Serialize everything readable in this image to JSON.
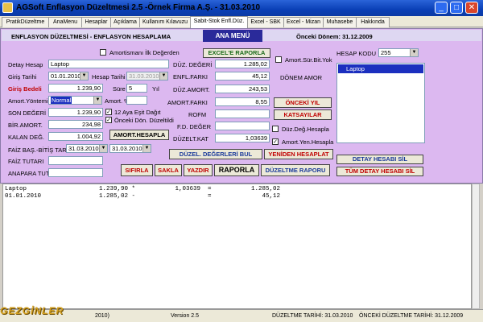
{
  "window": {
    "title": "AGSoft Enflasyon Düzeltmesi 2.5 -Örnek Firma A.Ş. - 31.03.2010"
  },
  "tabs": [
    {
      "label": "PratikDüzeltme"
    },
    {
      "label": "AnaMenu"
    },
    {
      "label": "Hesaplar"
    },
    {
      "label": "Açıklama"
    },
    {
      "label": "Kullanım Kılavuzu"
    },
    {
      "label": "Sabit-Stok Enfl.Düz."
    },
    {
      "label": "Excel - SBK"
    },
    {
      "label": "Excel - Mizan"
    },
    {
      "label": "Muhasebe"
    },
    {
      "label": "Hakkında"
    }
  ],
  "header": {
    "section_title": "ENFLASYON DÜZELTMESİ - ENFLASYON HESAPLAMA",
    "ana_menu": "ANA MENÜ",
    "onceki_donem": "Önceki Dönem: 31.12.2009"
  },
  "form": {
    "amortismani_ilk_degerden": "Amortismanı İlk Değerden",
    "detay_hesap_label": "Detay Hesap",
    "detay_hesap_value": "Laptop",
    "giris_tarihi_label": "Giriş Tarihi",
    "giris_tarihi_value": "01.01.2010",
    "hesap_tarihi_label": "Hesap Tarihi",
    "hesap_tarihi_value": "31.03.2010",
    "giris_bedeli_label": "Giriş Bedeli",
    "giris_bedeli_value": "1.239,90",
    "sure_label": "Süre",
    "sure_value": "5",
    "yil_label": "Yıl",
    "amort_yontemi_label": "Amort.Yöntemi",
    "amort_yontemi_value": "Normal",
    "amort_pct_label": "Amort. %",
    "amort_pct_value": "",
    "son_degeri_label": "SON DEĞERİ",
    "son_degeri_value": "1.239,90",
    "ay_esit_dagit": "12 Aya Eşit Dağıt",
    "onceki_don_duzeltildi": "Önceki Dön. Düzeltildi",
    "bir_amort_label": "BİR.AMORT.",
    "bir_amort_value": "234,98",
    "kalan_deg_label": "KALAN DEĞ.",
    "kalan_deg_value": "1.004,92",
    "amort_hesapla": "AMORT.HESAPLA",
    "faiz_bas_bitis_label": "FAİZ BAŞ.-BİTİŞ TAR.",
    "faiz_bas_value": "31.03.2010",
    "faiz_bitis_value": "31.03.2010",
    "faiz_tutari_label": "FAİZ TUTARI",
    "faiz_tutari_value": "",
    "anapara_tut_label": "ANAPARA TUT.",
    "anapara_tut_value": ""
  },
  "mid": {
    "duz_degeri_label": "DÜZ. DEĞERİ",
    "duz_degeri_value": "1.285,02",
    "enfl_farki_label": "ENFL.FARKI",
    "enfl_farki_value": "45,12",
    "duz_amort_label": "DÜZ.AMORT.",
    "duz_amort_value": "243,53",
    "amort_farki_label": "AMORT.FARKI",
    "amort_farki_value": "8,55",
    "rofm_label": "ROFM",
    "rofm_value": "",
    "fd_degeri_label": "F.D. DEĞER",
    "fd_degeri_value": "",
    "duzelt_kat_label": "DÜZELT.KAT",
    "duzelt_kat_value": "1,03639",
    "excel_raporla": "EXCEL'E RAPORLA"
  },
  "right": {
    "amort_sur_bit_yok": "Amort.Sür.Bit.Yok",
    "donem_amor": "DÖNEM AMOR",
    "onceki_yil": "ÖNCEKİ YIL",
    "katsayilar": "KATSAYILAR",
    "duz_deg_hesapla": "Düz.Değ.Hesapla",
    "amort_yen_hesapla": "Amort.Yen.Hesapla",
    "hesap_kodu_label": "HESAP KODU",
    "hesap_kodu_value": "255",
    "list_items": [
      "Laptop"
    ],
    "detay_hesabi_sil": "DETAY HESABI SİL",
    "tum_detay_hesabi_sil": "TÜM DETAY HESABI SİL"
  },
  "buttons": {
    "duzel_degerleri_bul": "DÜZEL. DEĞERLERİ BUL",
    "yeniden_hesaplat": "YENİDEN HESAPLAT",
    "sifirla": "SIFIRLA",
    "sakla": "SAKLA",
    "yazdir": "YAZDIR",
    "raporla": "RAPORLA",
    "duzeltme_raporu": "DÜZELTME RAPORU"
  },
  "output_rows": [
    "Laptop                    1.239,90 *           1,03639  =           1.285,02",
    "01.01.2010                1.285,02 -                    =              45,12"
  ],
  "status": {
    "left": "2010)",
    "version": "Version 2.5",
    "duzeltme_tarihi": "DÜZELTME TARİHİ: 31.03.2010",
    "onceki_duzeltme_tarihi": "ÖNCEKİ DÜZELTME TARİHİ: 31.12.2009"
  },
  "watermark": "GEZGİNLER"
}
